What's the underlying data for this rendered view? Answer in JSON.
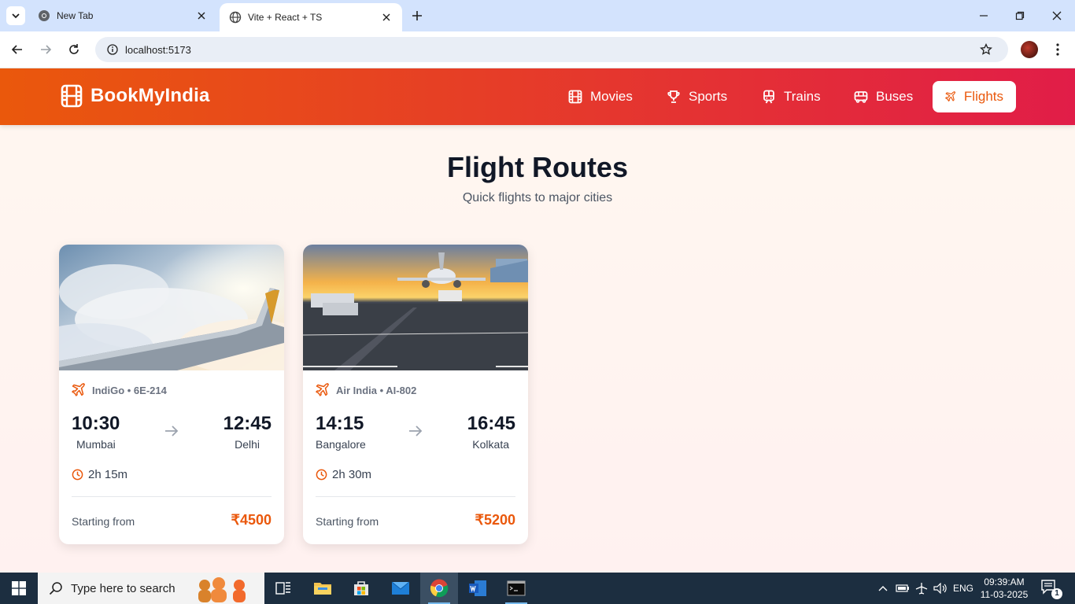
{
  "browser": {
    "tabs": [
      {
        "title": "New Tab",
        "active": false
      },
      {
        "title": "Vite + React + TS",
        "active": true
      }
    ],
    "url": "localhost:5173"
  },
  "app": {
    "brand": "BookMyIndia",
    "nav": [
      {
        "label": "Movies",
        "icon": "film-icon",
        "active": false
      },
      {
        "label": "Sports",
        "icon": "trophy-icon",
        "active": false
      },
      {
        "label": "Trains",
        "icon": "train-icon",
        "active": false
      },
      {
        "label": "Buses",
        "icon": "bus-icon",
        "active": false
      },
      {
        "label": "Flights",
        "icon": "plane-icon",
        "active": true
      }
    ],
    "heading": "Flight Routes",
    "subheading": "Quick flights to major cities",
    "flights": [
      {
        "airline": "IndiGo • 6E-214",
        "departure_time": "10:30",
        "departure_city": "Mumbai",
        "arrival_time": "12:45",
        "arrival_city": "Delhi",
        "duration": "2h 15m",
        "price_label": "Starting from",
        "price": "₹4500",
        "image": "airplane-wing-clouds"
      },
      {
        "airline": "Air India • AI-802",
        "departure_time": "14:15",
        "departure_city": "Bangalore",
        "arrival_time": "16:45",
        "arrival_city": "Kolkata",
        "duration": "2h 30m",
        "price_label": "Starting from",
        "price": "₹5200",
        "image": "airplane-on-tarmac-sunset"
      }
    ],
    "colors": {
      "accent": "#ea580c",
      "gradient_end": "#e11d48"
    }
  },
  "taskbar": {
    "search_placeholder": "Type here to search",
    "language": "ENG",
    "time": "09:39:AM",
    "date": "11-03-2025",
    "notification_count": "1"
  }
}
